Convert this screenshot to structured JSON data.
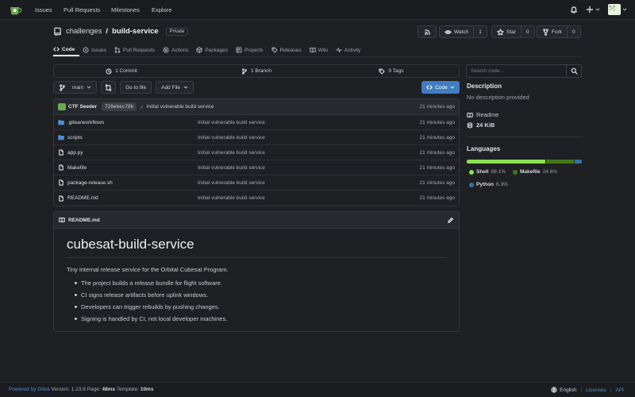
{
  "nav": {
    "items": [
      "Issues",
      "Pull Requests",
      "Milestones",
      "Explore"
    ]
  },
  "repo": {
    "owner": "challenges",
    "separator": "/",
    "name": "build-service",
    "visibility": "Private",
    "watch_label": "Watch",
    "watch_count": "1",
    "star_label": "Star",
    "star_count": "0",
    "fork_label": "Fork",
    "fork_count": "0"
  },
  "tabs": [
    {
      "label": "Code",
      "icon": "code-icon",
      "active": true
    },
    {
      "label": "Issues",
      "icon": "issue-icon"
    },
    {
      "label": "Pull Requests",
      "icon": "pull-request-icon"
    },
    {
      "label": "Actions",
      "icon": "actions-icon"
    },
    {
      "label": "Packages",
      "icon": "package-icon"
    },
    {
      "label": "Projects",
      "icon": "project-icon"
    },
    {
      "label": "Releases",
      "icon": "tag-icon"
    },
    {
      "label": "Wiki",
      "icon": "book-icon"
    },
    {
      "label": "Activity",
      "icon": "pulse-icon"
    }
  ],
  "stats": {
    "commits": "1 Commit",
    "branches": "1 Branch",
    "tags": "0 Tags"
  },
  "toolbar": {
    "branch": "main",
    "go_to_file": "Go to file",
    "add_file": "Add File",
    "code_button": "Code"
  },
  "last_commit": {
    "author": "CTF Seeder",
    "sha": "726ebec78b",
    "message": "Initial vulnerable build service",
    "time": "21 minutes ago"
  },
  "files": [
    {
      "name": ".gitea/workflows",
      "type": "folder",
      "message": "Initial vulnerable build service",
      "time": "21 minutes ago"
    },
    {
      "name": "scripts",
      "type": "folder",
      "message": "Initial vulnerable build service",
      "time": "21 minutes ago"
    },
    {
      "name": "app.py",
      "type": "file",
      "message": "Initial vulnerable build service",
      "time": "21 minutes ago"
    },
    {
      "name": "Makefile",
      "type": "file",
      "message": "Initial vulnerable build service",
      "time": "21 minutes ago"
    },
    {
      "name": "package-release.sh",
      "type": "file",
      "message": "Initial vulnerable build service",
      "time": "21 minutes ago"
    },
    {
      "name": "README.md",
      "type": "file",
      "message": "Initial vulnerable build service",
      "time": "21 minutes ago"
    }
  ],
  "readme": {
    "filename": "README.md",
    "title": "cubesat-build-service",
    "intro": "Tiny internal release service for the Orbital Cubesat Program.",
    "bullets": [
      "The project builds a release bundle for flight software.",
      "CI signs release artifacts before uplink windows.",
      "Developers can trigger rebuilds by pushing changes.",
      "Signing is handled by CI, not local developer machines."
    ]
  },
  "sidebar": {
    "search_placeholder": "Search code...",
    "description_heading": "Description",
    "description_text": "No description provided",
    "readme_link": "Readme",
    "size": "24 KiB",
    "languages_heading": "Languages",
    "languages": [
      {
        "name": "Shell",
        "percent": "69.1%",
        "value": 69.1,
        "color": "#89e051"
      },
      {
        "name": "Makefile",
        "percent": "24.6%",
        "value": 24.6,
        "color": "#427819"
      },
      {
        "name": "Python",
        "percent": "6.3%",
        "value": 6.3,
        "color": "#3572a5"
      }
    ]
  },
  "footer": {
    "powered_by": "Powered by Gitea",
    "version_label": "Version:",
    "version": "1.23.8",
    "page_label": "Page:",
    "page_time": "48ms",
    "template_label": "Template:",
    "template_time": "10ms",
    "language": "English",
    "licenses": "Licenses",
    "api": "API"
  },
  "colors": {
    "accent": "#3f7fc1",
    "background": "#1e2024",
    "folder": "#4a90d9"
  }
}
